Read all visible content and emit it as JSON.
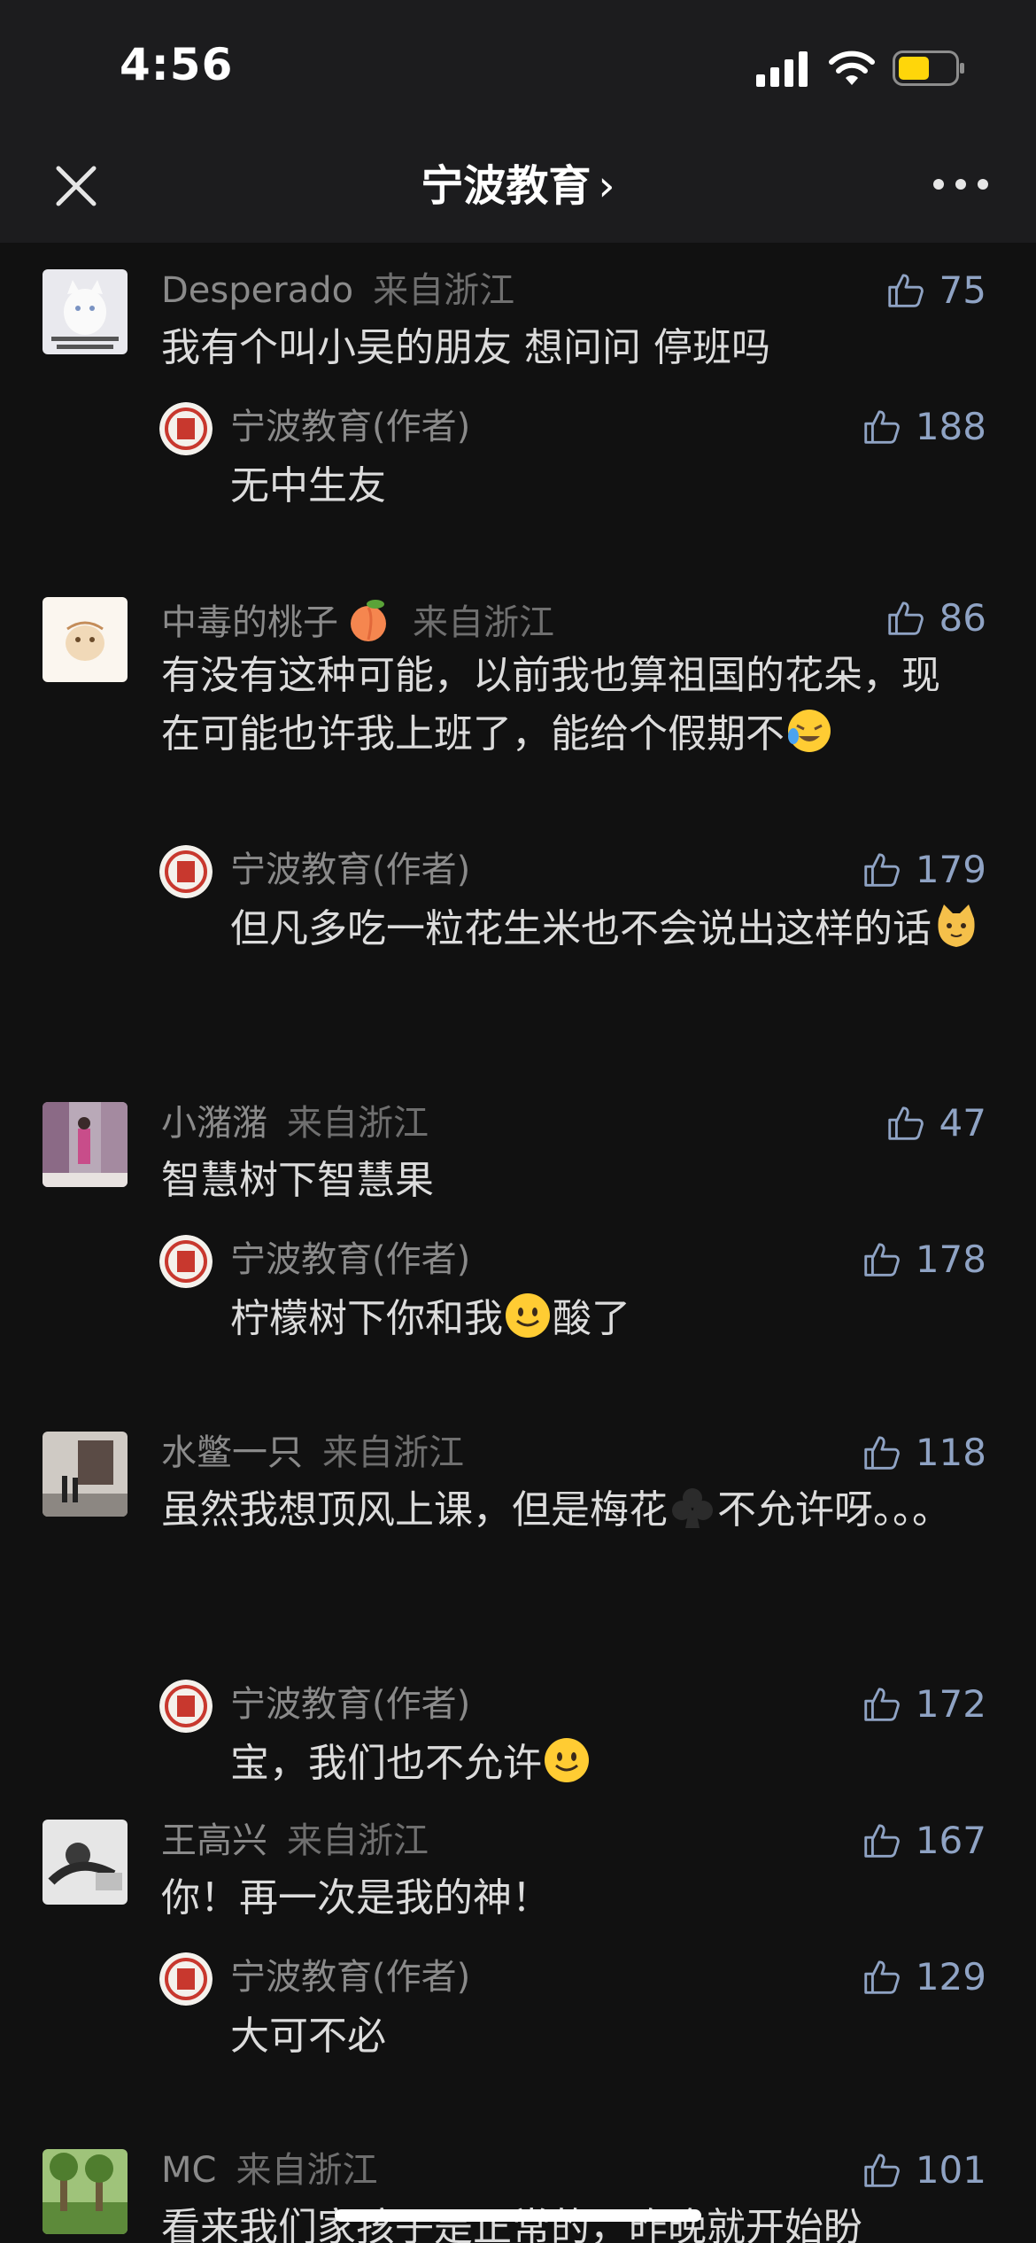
{
  "status_bar": {
    "time": "4:56",
    "battery_color": "#ffd60a"
  },
  "nav": {
    "title": "宁波教育",
    "chevron": "›"
  },
  "comments": [
    {
      "name": "Desperado",
      "location": "来自浙江",
      "likes": "75",
      "text": "我有个叫小吴的朋友 想问问 停班吗",
      "reply": {
        "name": "宁波教育(作者)",
        "likes": "188",
        "text": "无中生友"
      }
    },
    {
      "name": "中毒的桃子",
      "location": "来自浙江",
      "likes": "86",
      "text": "有没有这种可能，以前我也算祖国的花朵，现在可能也许我上班了，能给个假期不",
      "reply": {
        "name": "宁波教育(作者)",
        "likes": "179",
        "text": "但凡多吃一粒花生米也不会说出这样的话"
      }
    },
    {
      "name": "小潴潴",
      "location": "来自浙江",
      "likes": "47",
      "text": "智慧树下智慧果",
      "reply": {
        "name": "宁波教育(作者)",
        "likes": "178",
        "text": "柠檬树下你和我",
        "text_after": "酸了"
      }
    },
    {
      "name": "水鳖一只",
      "location": "来自浙江",
      "likes": "118",
      "text": "虽然我想顶风上课，但是梅花",
      "text_after": "不允许呀。。。",
      "reply": {
        "name": "宁波教育(作者)",
        "likes": "172",
        "text": "宝，我们也不允许"
      }
    },
    {
      "name": "王高兴",
      "location": "来自浙江",
      "likes": "167",
      "text": "你！再一次是我的神！",
      "reply": {
        "name": "宁波教育(作者)",
        "likes": "129",
        "text": "大可不必"
      }
    },
    {
      "name": "MC",
      "location": "来自浙江",
      "likes": "101",
      "text": "看来我们家孩子是正常的，昨晚就开始盼"
    }
  ]
}
